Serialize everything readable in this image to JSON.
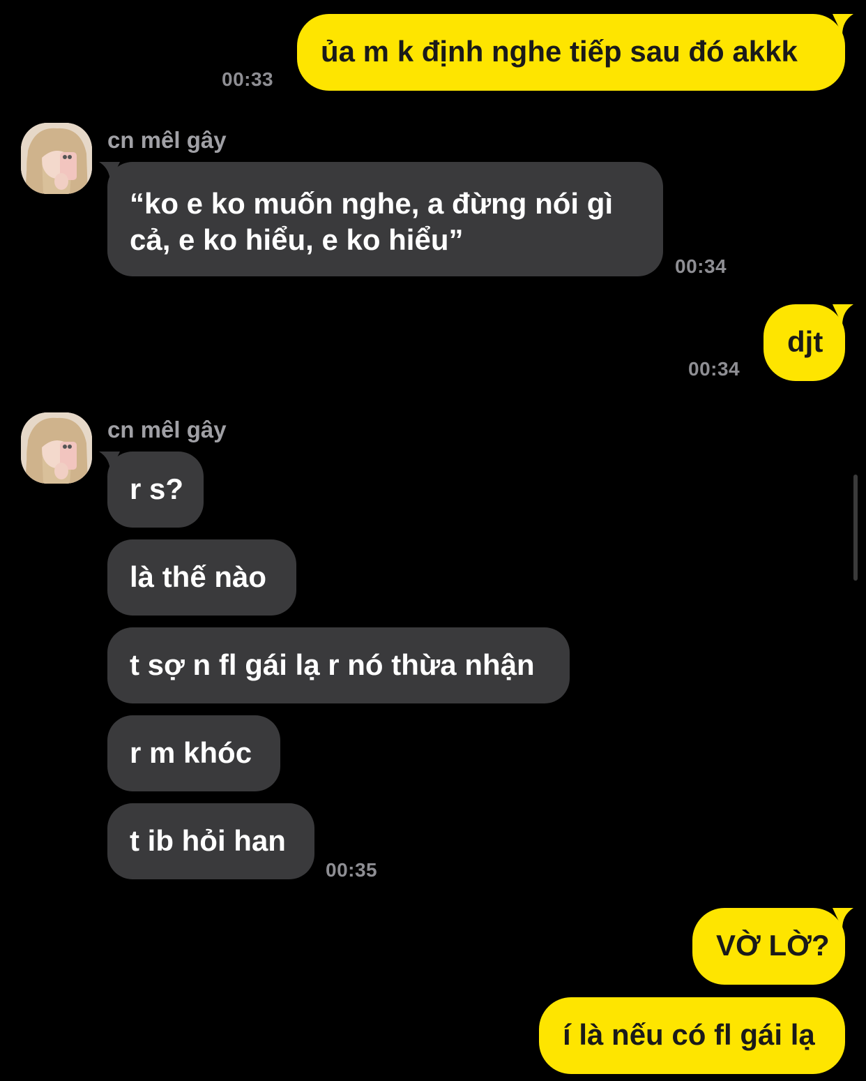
{
  "sender_name": "cn mêl gây",
  "colors": {
    "background": "#000000",
    "outgoing_bubble": "#FEE500",
    "incoming_bubble": "#3a3a3c",
    "timestamp": "#8e8e93"
  },
  "messages": [
    {
      "id": "m1",
      "direction": "outgoing",
      "text": "ủa m k định nghe tiếp sau đó akkk",
      "time": "00:33"
    },
    {
      "id": "m2",
      "direction": "incoming",
      "text": "“ko e ko muốn nghe, a đừng nói gì cả, e ko hiểu, e ko hiểu”",
      "time": "00:34"
    },
    {
      "id": "m3",
      "direction": "outgoing",
      "text": "djt",
      "time": "00:34"
    },
    {
      "id": "m4",
      "direction": "incoming",
      "text": "r s?"
    },
    {
      "id": "m5",
      "direction": "incoming",
      "text": "là thế nào"
    },
    {
      "id": "m6",
      "direction": "incoming",
      "text": "t sợ n fl gái lạ r nó thừa nhận"
    },
    {
      "id": "m7",
      "direction": "incoming",
      "text": "r m khóc"
    },
    {
      "id": "m8",
      "direction": "incoming",
      "text": "t ib hỏi han",
      "time": "00:35"
    },
    {
      "id": "m9",
      "direction": "outgoing",
      "text": "VỜ LỜ?"
    },
    {
      "id": "m10",
      "direction": "outgoing",
      "text": "í là nếu có fl gái lạ"
    }
  ]
}
